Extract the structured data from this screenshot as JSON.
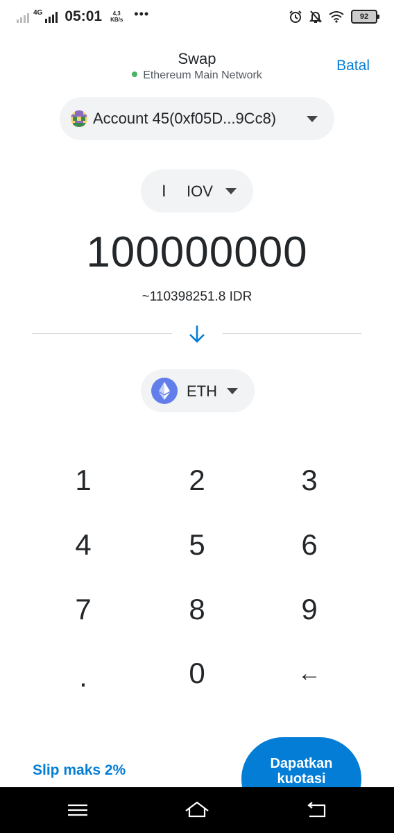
{
  "status_bar": {
    "network": "4G",
    "time": "05:01",
    "speed_value": "4,3",
    "speed_unit": "KB/s",
    "more": "•••",
    "battery": "92"
  },
  "header": {
    "title": "Swap",
    "network_name": "Ethereum Main Network",
    "cancel_label": "Batal"
  },
  "account": {
    "label": "Account 45(0xf05D...9Cc8)"
  },
  "source_token": {
    "cursor": "I",
    "symbol": "IOV"
  },
  "amount": {
    "value": "100000000",
    "fiat": "~110398251.8 IDR"
  },
  "destination_token": {
    "symbol": "ETH"
  },
  "keypad": {
    "keys": [
      "1",
      "2",
      "3",
      "4",
      "5",
      "6",
      "7",
      "8",
      "9",
      ".",
      "0",
      "←"
    ]
  },
  "footer": {
    "slippage_label": "Slip maks 2%",
    "quote_label_line1": "Dapatkan",
    "quote_label_line2": "kuotasi"
  },
  "colors": {
    "accent": "#037dd6",
    "network_dot": "#28a745",
    "eth": "#627eea"
  }
}
